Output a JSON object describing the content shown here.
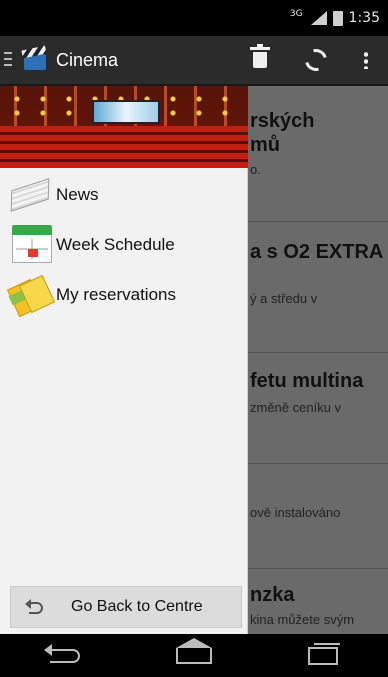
{
  "status_bar": {
    "time": "1:35",
    "network_label": "3G"
  },
  "action_bar": {
    "title": "Cinema",
    "actions": [
      "trash-icon",
      "refresh-icon",
      "overflow-menu-icon"
    ]
  },
  "background_articles": [
    {
      "title": "rských",
      "title2": "mů",
      "snippet": "o."
    },
    {
      "title": "a s O2 EXTRA",
      "snippet": "ý a středu v"
    },
    {
      "title": "fetu multina",
      "snippet": "změně ceníku v"
    },
    {
      "title": "",
      "snippet": "ově instalováno"
    },
    {
      "title": "nzka",
      "snippet": "kina můžete svým"
    }
  ],
  "drawer": {
    "items": [
      {
        "label": "News",
        "icon": "newspaper-icon"
      },
      {
        "label": "Week Schedule",
        "icon": "calendar-icon"
      },
      {
        "label": "My reservations",
        "icon": "ticket-icon"
      }
    ],
    "back_button": {
      "label": "Go Back to Centre",
      "icon": "undo-icon"
    }
  },
  "nav_bar": [
    "back-nav-icon",
    "home-nav-icon",
    "recents-nav-icon"
  ]
}
